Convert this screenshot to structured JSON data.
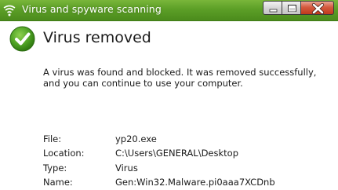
{
  "window": {
    "title": "Virus and spyware scanning",
    "accent_color": "#5c9f27",
    "icons": {
      "title": "green-shield-wave-icon",
      "status": "green-checkmark-icon",
      "minimize": "minimize-icon",
      "maximize": "maximize-icon",
      "close": "close-icon"
    }
  },
  "result": {
    "heading": "Virus removed",
    "message": "A virus was found and blocked. It was removed successfully, and you can continue to use your computer."
  },
  "details": [
    {
      "label": "File:",
      "value": "yp20.exe"
    },
    {
      "label": "Location:",
      "value": "C:\\Users\\GENERAL\\Desktop"
    },
    {
      "label": "Type:",
      "value": "Virus"
    },
    {
      "label": "Name:",
      "value": "Gen:Win32.Malware.pi0aaa7XCDnb"
    }
  ]
}
